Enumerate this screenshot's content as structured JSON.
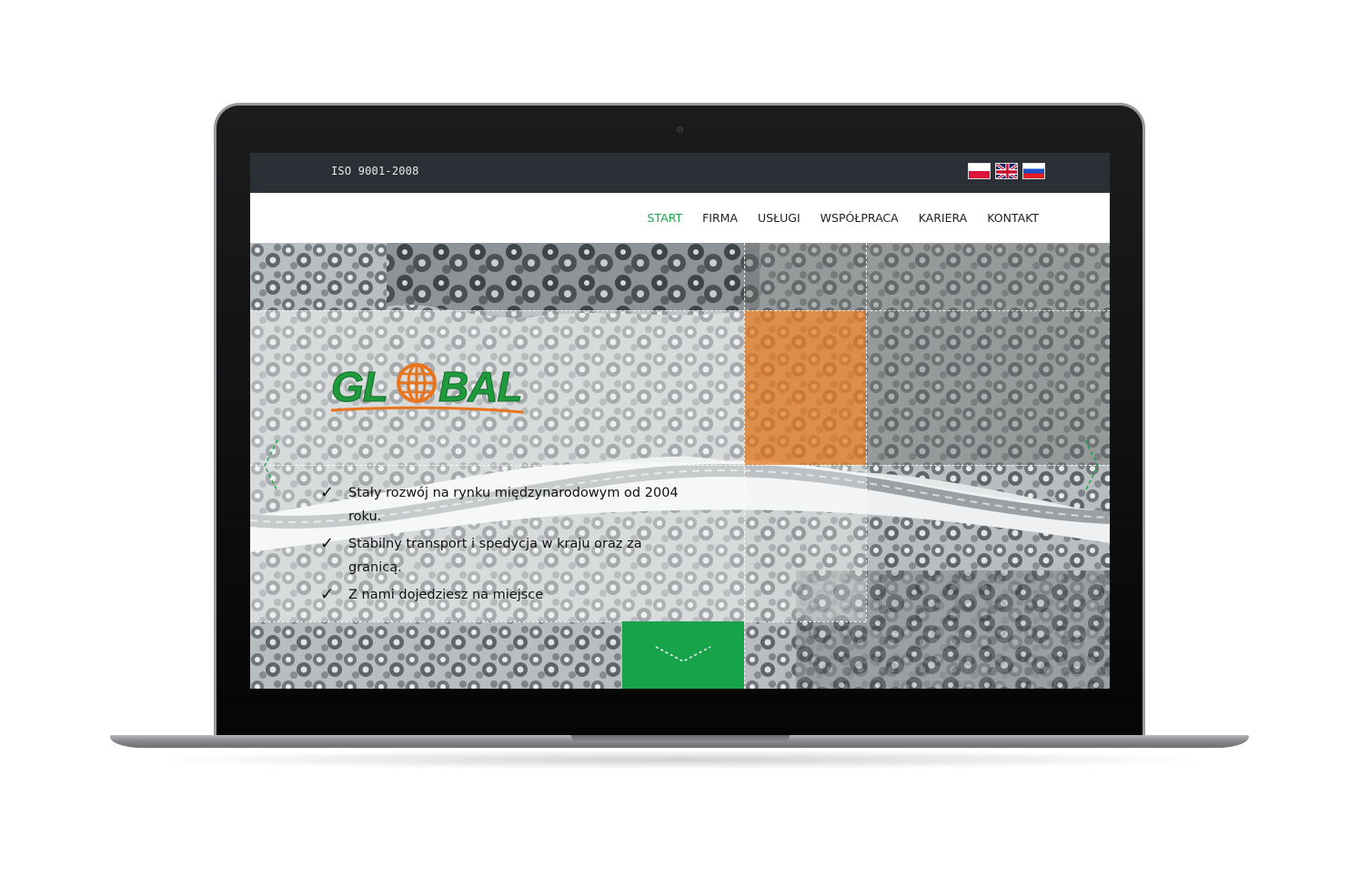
{
  "topbar": {
    "iso_label": "ISO 9001-2008",
    "languages": [
      "polish-flag",
      "english-flag",
      "russian-flag"
    ]
  },
  "nav": {
    "items": [
      {
        "label": "START",
        "active": true
      },
      {
        "label": "FIRMA",
        "active": false
      },
      {
        "label": "USŁUGI",
        "active": false
      },
      {
        "label": "WSPÓŁPRACA",
        "active": false
      },
      {
        "label": "KARIERA",
        "active": false
      },
      {
        "label": "KONTAKT",
        "active": false
      }
    ]
  },
  "hero": {
    "logo_text": "GLOBAL",
    "bullets": [
      "Stały rozwój na rynku międzynarodowym od 2004 roku.",
      "Stabilny transport i spedycja w kraju oraz za granicą.",
      "Z nami dojedziesz na miejsce"
    ],
    "check_glyph": "✓"
  },
  "colors": {
    "accent_green": "#1aa64a",
    "accent_orange": "#e88028",
    "topbar_bg": "#2b3036",
    "logo_green": "#1f9a3c",
    "logo_orange": "#e8741e"
  },
  "icons": [
    "chevron-left-icon",
    "chevron-right-icon",
    "chevron-down-icon",
    "check-icon",
    "globe-icon"
  ]
}
